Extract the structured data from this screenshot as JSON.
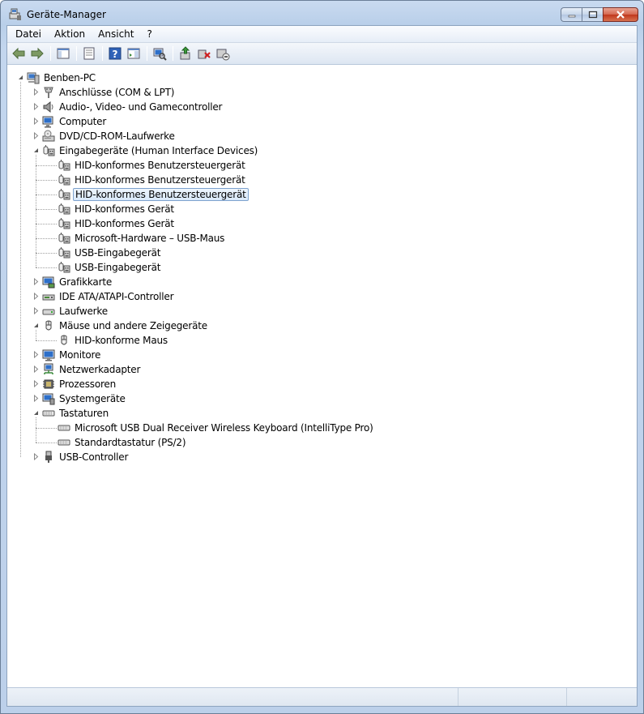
{
  "window": {
    "title": "Geräte-Manager"
  },
  "menu": [
    "Datei",
    "Aktion",
    "Ansicht",
    "?"
  ],
  "toolbar": [
    {
      "name": "back-button",
      "icon": "arrow-left-icon"
    },
    {
      "name": "forward-button",
      "icon": "arrow-right-icon"
    },
    {
      "sep": true
    },
    {
      "name": "show-hide-tree-button",
      "icon": "console-tree-icon"
    },
    {
      "sep": true
    },
    {
      "name": "properties-button",
      "icon": "properties-icon"
    },
    {
      "sep": true
    },
    {
      "name": "help-button",
      "icon": "help-icon"
    },
    {
      "name": "show-action-pane-button",
      "icon": "action-pane-icon"
    },
    {
      "sep": true
    },
    {
      "name": "scan-hardware-button",
      "icon": "scan-hardware-icon"
    },
    {
      "sep": true
    },
    {
      "name": "update-driver-button",
      "icon": "update-driver-icon"
    },
    {
      "name": "uninstall-button",
      "icon": "uninstall-icon"
    },
    {
      "name": "disable-button",
      "icon": "disable-icon"
    }
  ],
  "tree": {
    "root": "Benben-PC",
    "categories": [
      {
        "label": "Anschlüsse (COM & LPT)",
        "icon": "port-icon",
        "expanded": false,
        "children": []
      },
      {
        "label": "Audio-, Video- und Gamecontroller",
        "icon": "speaker-icon",
        "expanded": false,
        "children": []
      },
      {
        "label": "Computer",
        "icon": "computer-icon",
        "expanded": false,
        "children": []
      },
      {
        "label": "DVD/CD-ROM-Laufwerke",
        "icon": "dvd-drive-icon",
        "expanded": false,
        "children": []
      },
      {
        "label": "Eingabegeräte (Human Interface Devices)",
        "icon": "hid-icon",
        "expanded": true,
        "children": [
          {
            "label": "HID-konformes Benutzersteuergerät",
            "icon": "hid-icon"
          },
          {
            "label": "HID-konformes Benutzersteuergerät",
            "icon": "hid-icon"
          },
          {
            "label": "HID-konformes Benutzersteuergerät",
            "icon": "hid-icon",
            "selected": true
          },
          {
            "label": "HID-konformes Gerät",
            "icon": "hid-icon"
          },
          {
            "label": "HID-konformes Gerät",
            "icon": "hid-icon"
          },
          {
            "label": "Microsoft-Hardware – USB-Maus",
            "icon": "hid-icon"
          },
          {
            "label": "USB-Eingabegerät",
            "icon": "hid-icon"
          },
          {
            "label": "USB-Eingabegerät",
            "icon": "hid-icon"
          }
        ]
      },
      {
        "label": "Grafikkarte",
        "icon": "display-adapter-icon",
        "expanded": false,
        "children": []
      },
      {
        "label": "IDE ATA/ATAPI-Controller",
        "icon": "ide-controller-icon",
        "expanded": false,
        "children": []
      },
      {
        "label": "Laufwerke",
        "icon": "disk-drive-icon",
        "expanded": false,
        "children": []
      },
      {
        "label": "Mäuse und andere Zeigegeräte",
        "icon": "mouse-icon",
        "expanded": true,
        "children": [
          {
            "label": "HID-konforme Maus",
            "icon": "mouse-icon"
          }
        ]
      },
      {
        "label": "Monitore",
        "icon": "monitor-icon",
        "expanded": false,
        "children": []
      },
      {
        "label": "Netzwerkadapter",
        "icon": "network-adapter-icon",
        "expanded": false,
        "children": []
      },
      {
        "label": "Prozessoren",
        "icon": "processor-icon",
        "expanded": false,
        "children": []
      },
      {
        "label": "Systemgeräte",
        "icon": "system-device-icon",
        "expanded": false,
        "children": []
      },
      {
        "label": "Tastaturen",
        "icon": "keyboard-icon",
        "expanded": true,
        "children": [
          {
            "label": "Microsoft USB Dual Receiver Wireless Keyboard (IntelliType Pro)",
            "icon": "keyboard-icon"
          },
          {
            "label": "Standardtastatur (PS/2)",
            "icon": "keyboard-icon"
          }
        ]
      },
      {
        "label": "USB-Controller",
        "icon": "usb-icon",
        "expanded": false,
        "children": []
      }
    ]
  }
}
